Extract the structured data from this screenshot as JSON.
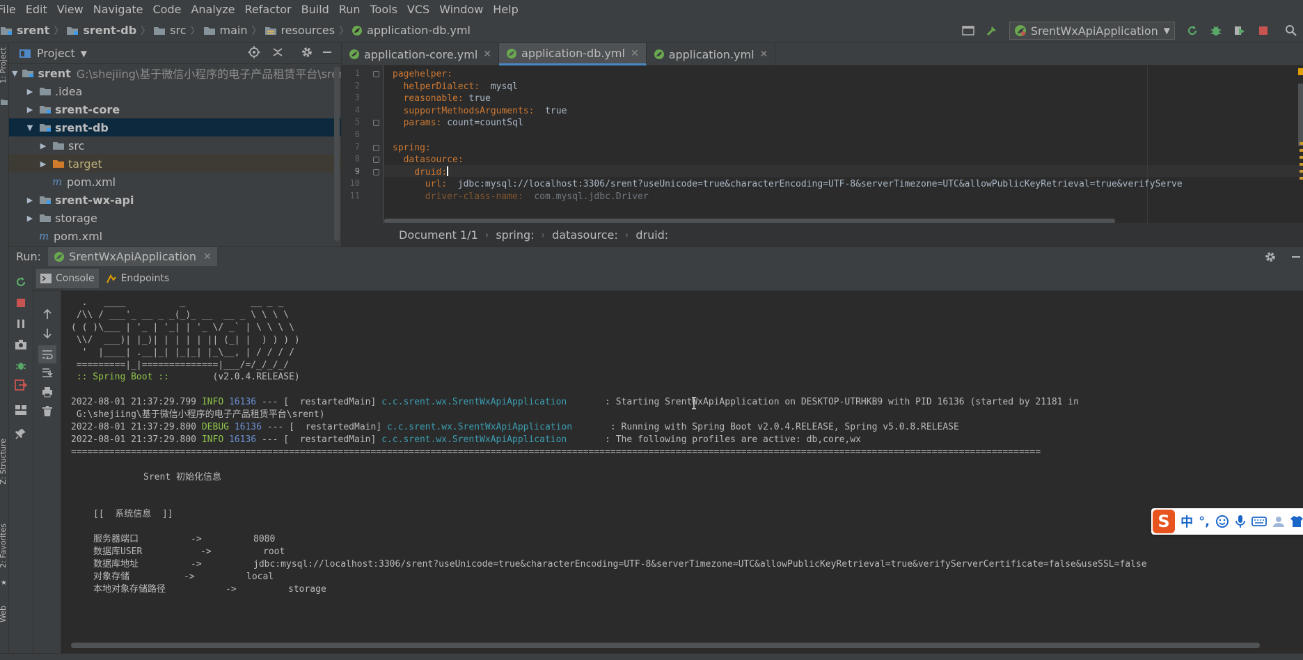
{
  "menu": [
    "File",
    "Edit",
    "View",
    "Navigate",
    "Code",
    "Analyze",
    "Refactor",
    "Build",
    "Run",
    "Tools",
    "VCS",
    "Window",
    "Help"
  ],
  "breadcrumbs": [
    "srent",
    "srent-db",
    "src",
    "main",
    "resources",
    "application-db.yml"
  ],
  "run_config": {
    "name": "SrentWxApiApplication"
  },
  "left_stripe": {
    "project": "1: Project",
    "structure": "Z: Structure",
    "favorites": "2: Favorites",
    "web": "Web"
  },
  "project_panel": {
    "title": "Project",
    "tree": [
      {
        "name": "srent",
        "path": "G:\\shejiing\\基于微信小程序的电子产品租赁平台\\srent",
        "level": 0,
        "expanded": true,
        "bold": true,
        "icon": "module-folder-icon"
      },
      {
        "name": ".idea",
        "level": 1,
        "expanded": false,
        "icon": "folder-icon"
      },
      {
        "name": "srent-core",
        "level": 1,
        "expanded": false,
        "bold": true,
        "icon": "module-folder-icon"
      },
      {
        "name": "srent-db",
        "level": 1,
        "expanded": true,
        "bold": true,
        "icon": "module-folder-icon",
        "selected": true
      },
      {
        "name": "src",
        "level": 2,
        "expanded": false,
        "icon": "folder-icon"
      },
      {
        "name": "target",
        "level": 2,
        "expanded": false,
        "icon": "excluded-folder-icon",
        "ignored": true
      },
      {
        "name": "pom.xml",
        "level": 2,
        "icon": "maven-file-icon"
      },
      {
        "name": "srent-wx-api",
        "level": 1,
        "expanded": false,
        "bold": true,
        "icon": "module-folder-icon"
      },
      {
        "name": "storage",
        "level": 1,
        "expanded": false,
        "icon": "folder-icon"
      },
      {
        "name": "pom.xml",
        "level": 1,
        "icon": "maven-file-icon"
      }
    ]
  },
  "editor": {
    "tabs": [
      {
        "label": "application-core.yml",
        "active": false
      },
      {
        "label": "application-db.yml",
        "active": true
      },
      {
        "label": "application.yml",
        "active": false
      }
    ],
    "lines": [
      {
        "n": "1",
        "key": "pagehelper:",
        "value": "",
        "indent": 0
      },
      {
        "n": "2",
        "key": "helperDialect:",
        "value": "  mysql",
        "indent": 2
      },
      {
        "n": "3",
        "key": "reasonable:",
        "value": " true",
        "indent": 2
      },
      {
        "n": "4",
        "key": "supportMethodsArguments:",
        "value": "  true",
        "indent": 2
      },
      {
        "n": "5",
        "key": "params:",
        "value": " count=countSql",
        "indent": 2
      },
      {
        "n": "6",
        "key": "",
        "value": "",
        "indent": 0
      },
      {
        "n": "7",
        "key": "spring:",
        "value": "",
        "indent": 0
      },
      {
        "n": "8",
        "key": "datasource:",
        "value": "",
        "indent": 2
      },
      {
        "n": "9",
        "key": "druid:",
        "value": "",
        "indent": 4
      },
      {
        "n": "10",
        "key": "url:",
        "value": "  jdbc:mysql://localhost:3306/srent?useUnicode=true&characterEncoding=UTF-8&serverTimezone=UTC&allowPublicKeyRetrieval=true&verifyServe",
        "indent": 6
      },
      {
        "n": "11",
        "key": "driver-class-name:",
        "value": "  com.mysql.jdbc.Driver",
        "indent": 6
      }
    ],
    "current_line": 9,
    "breadcrumb": [
      "Document 1/1",
      "spring:",
      "datasource:",
      "druid:"
    ]
  },
  "run_panel": {
    "label": "Run:",
    "tab": "SrentWxApiApplication",
    "subtabs": [
      "Console",
      "Endpoints"
    ]
  },
  "console": {
    "banner": [
      "  .   ____          _            __ _ _",
      " /\\\\ / ___'_ __ _ _(_)_ __  __ _ \\ \\ \\ \\",
      "( ( )\\___ | '_ | '_| | '_ \\/ _` | \\ \\ \\ \\",
      " \\\\/  ___)| |_)| | | | | || (_| |  ) ) ) )",
      "  '  |____| .__|_| |_|_| |_\\__, | / / / /",
      " =========|_|==============|___/=/_/_/_/"
    ],
    "spring_boot_label": " :: Spring Boot ::",
    "spring_boot_version": "        (v2.0.4.RELEASE)",
    "logs": [
      {
        "ts": "2022-08-01 21:37:29.799",
        "level": "INFO",
        "pid": "16136",
        "sep": "--- [  restartedMain]",
        "logger": "c.c.srent.wx.SrentWxApiApplication",
        "msg": ": Starting SrentWxApiApplication on DESKTOP-UTRHKB9 with PID 16136 (started by 21181 in"
      },
      {
        "cont": " G:\\shejiing\\基于微信小程序的电子产品租赁平台\\srent)"
      },
      {
        "ts": "2022-08-01 21:37:29.800",
        "level": "DEBUG",
        "pid": "16136",
        "sep": "--- [  restartedMain]",
        "logger": "c.c.srent.wx.SrentWxApiApplication",
        "msg": ": Running with Spring Boot v2.0.4.RELEASE, Spring v5.0.8.RELEASE"
      },
      {
        "ts": "2022-08-01 21:37:29.800",
        "level": "INFO",
        "pid": "16136",
        "sep": "--- [  restartedMain]",
        "logger": "c.c.srent.wx.SrentWxApiApplication",
        "msg": ": The following profiles are active: db,core,wx"
      }
    ],
    "divider": "==================================================================================================================================================================================",
    "init_title": "Srent 初始化信息",
    "section": "[[  系统信息  ]]",
    "info": [
      {
        "label": "服务器端口",
        "arrow": "->",
        "value": "8080"
      },
      {
        "label": "数据库USER",
        "arrow": "->",
        "value": "root"
      },
      {
        "label": "数据库地址",
        "arrow": "->",
        "value": "jdbc:mysql://localhost:3306/srent?useUnicode=true&characterEncoding=UTF-8&serverTimezone=UTC&allowPublicKeyRetrieval=true&verifyServerCertificate=false&useSSL=false"
      },
      {
        "label": "对象存储",
        "arrow": "->",
        "value": "local"
      },
      {
        "label": "本地对象存储路径",
        "arrow": "->",
        "value": "storage"
      }
    ]
  },
  "ime": {
    "logo": "S",
    "mode": "中",
    "punct": "°,"
  },
  "colors": {
    "accent": "#4a88c7",
    "green": "#8fc24a",
    "cyan": "#3c9eb1",
    "blue": "#6a8fd0",
    "keyword": "#cc7832",
    "stop": "#c75450"
  }
}
